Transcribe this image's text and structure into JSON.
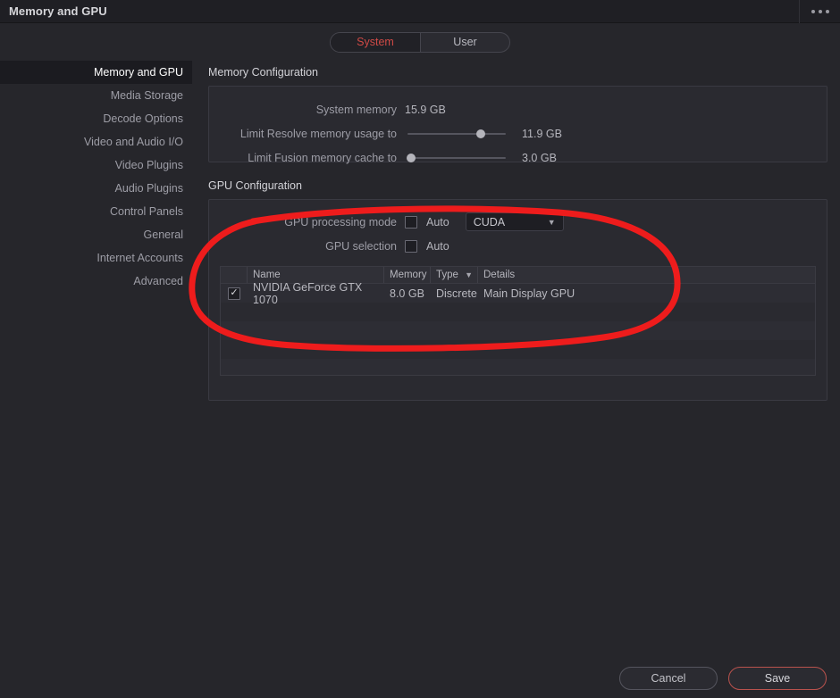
{
  "window": {
    "title": "Memory and GPU",
    "overflow_menu_icon": "ellipsis-horizontal-icon"
  },
  "tabs": [
    {
      "label": "System",
      "active": true
    },
    {
      "label": "User",
      "active": false
    }
  ],
  "sidebar": {
    "items": [
      {
        "label": "Memory and GPU",
        "active": true
      },
      {
        "label": "Media Storage",
        "active": false
      },
      {
        "label": "Decode Options",
        "active": false
      },
      {
        "label": "Video and Audio I/O",
        "active": false
      },
      {
        "label": "Video Plugins",
        "active": false
      },
      {
        "label": "Audio Plugins",
        "active": false
      },
      {
        "label": "Control Panels",
        "active": false
      },
      {
        "label": "General",
        "active": false
      },
      {
        "label": "Internet Accounts",
        "active": false
      },
      {
        "label": "Advanced",
        "active": false
      }
    ]
  },
  "memory_configuration": {
    "section_title": "Memory Configuration",
    "system_memory": {
      "label": "System memory",
      "value": "15.9 GB"
    },
    "resolve_limit": {
      "label": "Limit Resolve memory usage to",
      "value": "11.9 GB",
      "slider_percent": 75
    },
    "fusion_limit": {
      "label": "Limit Fusion memory cache to",
      "value": "3.0 GB",
      "slider_percent": 2
    }
  },
  "gpu_configuration": {
    "section_title": "GPU Configuration",
    "processing_mode": {
      "label": "GPU processing mode",
      "auto_label": "Auto",
      "auto_checked": false,
      "mode_value": "CUDA",
      "chevron_icon": "chevron-down-icon"
    },
    "gpu_selection": {
      "label": "GPU selection",
      "auto_label": "Auto",
      "auto_checked": false
    },
    "table": {
      "columns": [
        "",
        "Name",
        "Memory",
        "Type",
        "Details"
      ],
      "sort_icon": "chevron-down-icon",
      "rows": [
        {
          "checked": true,
          "check_glyph": "✓",
          "name": "NVIDIA GeForce GTX 1070",
          "memory": "8.0 GB",
          "type": "Discrete",
          "details": "Main Display GPU"
        }
      ]
    }
  },
  "footer": {
    "cancel_label": "Cancel",
    "save_label": "Save"
  },
  "annotation": {
    "shape": "hand-drawn-ellipse",
    "color": "#ee1c1c"
  }
}
